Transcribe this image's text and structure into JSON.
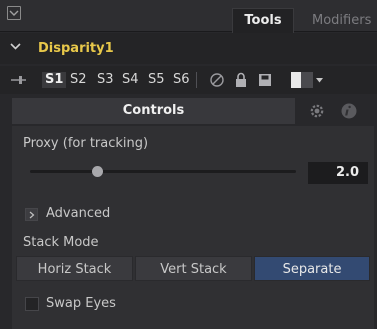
{
  "header": {
    "tabs": [
      {
        "label": "Tools",
        "active": true
      },
      {
        "label": "Modifiers",
        "active": false
      }
    ]
  },
  "tool": {
    "name": "Disparity1",
    "name_color": "#e8c84a"
  },
  "versions": {
    "items": [
      "S1",
      "S2",
      "S3",
      "S4",
      "S5",
      "S6"
    ],
    "active": "S1"
  },
  "panel_tabs": {
    "controls_label": "Controls"
  },
  "controls": {
    "proxy": {
      "label": "Proxy (for tracking)",
      "value": "2.0"
    },
    "advanced": {
      "label": "Advanced"
    },
    "stack_mode": {
      "label": "Stack Mode",
      "options": [
        "Horiz Stack",
        "Vert Stack",
        "Separate"
      ],
      "selected": "Separate"
    },
    "swap_eyes": {
      "label": "Swap Eyes",
      "checked": false
    }
  },
  "colors": {
    "selected_button": "#334a72",
    "tool_name": "#e8c84a"
  }
}
